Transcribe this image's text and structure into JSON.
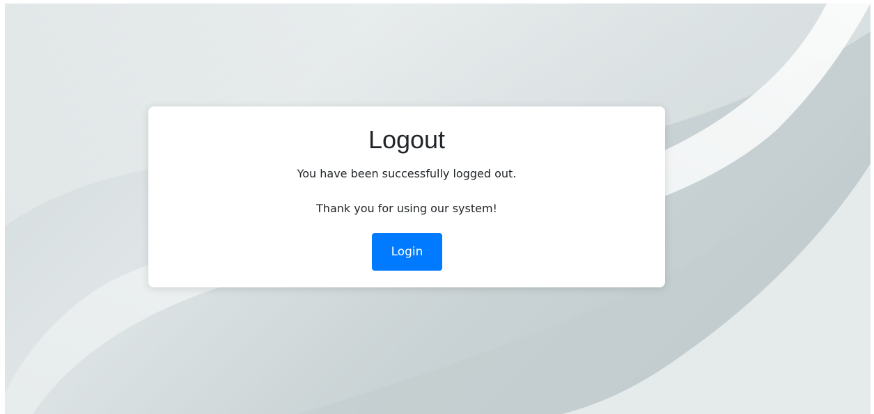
{
  "page": {
    "title": "Logout",
    "message_primary": "You have been successfully logged out.",
    "message_secondary": "Thank you for using our system!",
    "login_button_label": "Login"
  },
  "colors": {
    "primary_button": "#007bff",
    "card_background": "#ffffff",
    "text": "#212529"
  }
}
